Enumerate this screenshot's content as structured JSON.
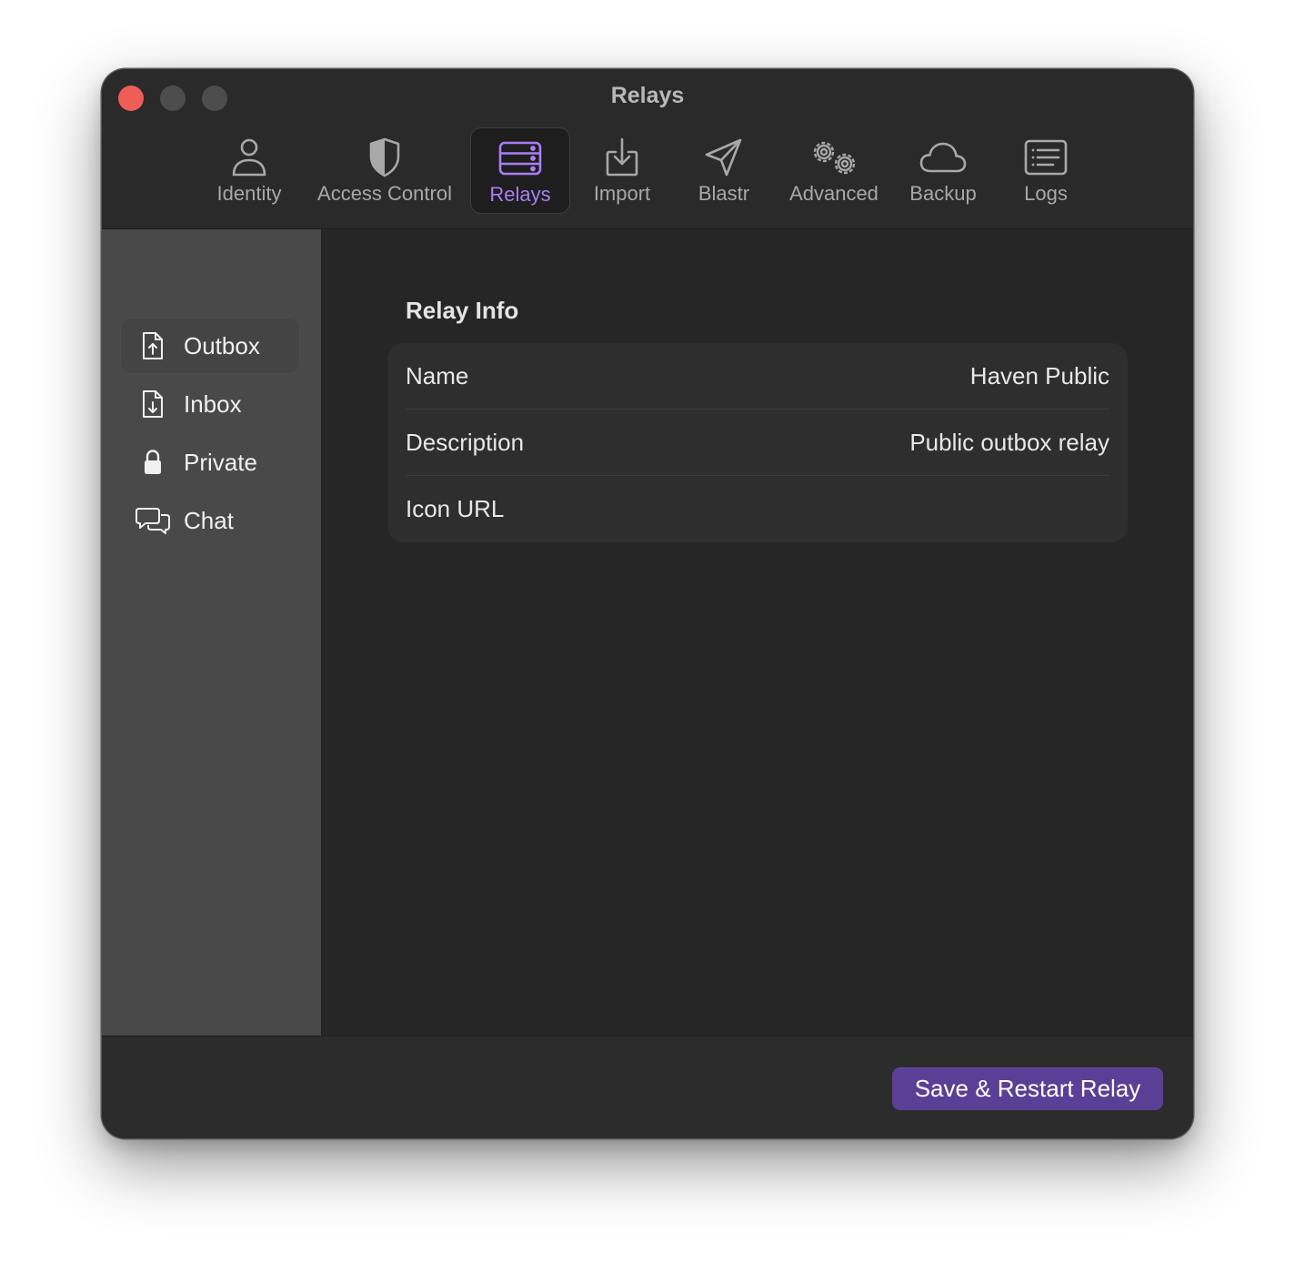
{
  "window": {
    "title": "Relays"
  },
  "toolbar": {
    "tabs": [
      {
        "label": "Identity",
        "icon": "person-icon",
        "active": false
      },
      {
        "label": "Access Control",
        "icon": "shield-icon",
        "active": false
      },
      {
        "label": "Relays",
        "icon": "server-icon",
        "active": true
      },
      {
        "label": "Import",
        "icon": "import-icon",
        "active": false
      },
      {
        "label": "Blastr",
        "icon": "paperplane-icon",
        "active": false
      },
      {
        "label": "Advanced",
        "icon": "gears-icon",
        "active": false
      },
      {
        "label": "Backup",
        "icon": "cloud-icon",
        "active": false
      },
      {
        "label": "Logs",
        "icon": "list-icon",
        "active": false
      }
    ]
  },
  "sidebar": {
    "items": [
      {
        "label": "Outbox",
        "icon": "doc-upload-icon",
        "selected": true
      },
      {
        "label": "Inbox",
        "icon": "doc-download-icon",
        "selected": false
      },
      {
        "label": "Private",
        "icon": "lock-icon",
        "selected": false
      },
      {
        "label": "Chat",
        "icon": "chat-bubbles-icon",
        "selected": false
      }
    ]
  },
  "main": {
    "section_title": "Relay Info",
    "fields": [
      {
        "label": "Name",
        "value": "Haven Public"
      },
      {
        "label": "Description",
        "value": "Public outbox relay"
      },
      {
        "label": "Icon URL",
        "value": ""
      }
    ]
  },
  "footer": {
    "save_label": "Save & Restart Relay"
  },
  "colors": {
    "accent": "#a97ef5",
    "button": "#5a3f96",
    "close": "#ee5e57"
  }
}
